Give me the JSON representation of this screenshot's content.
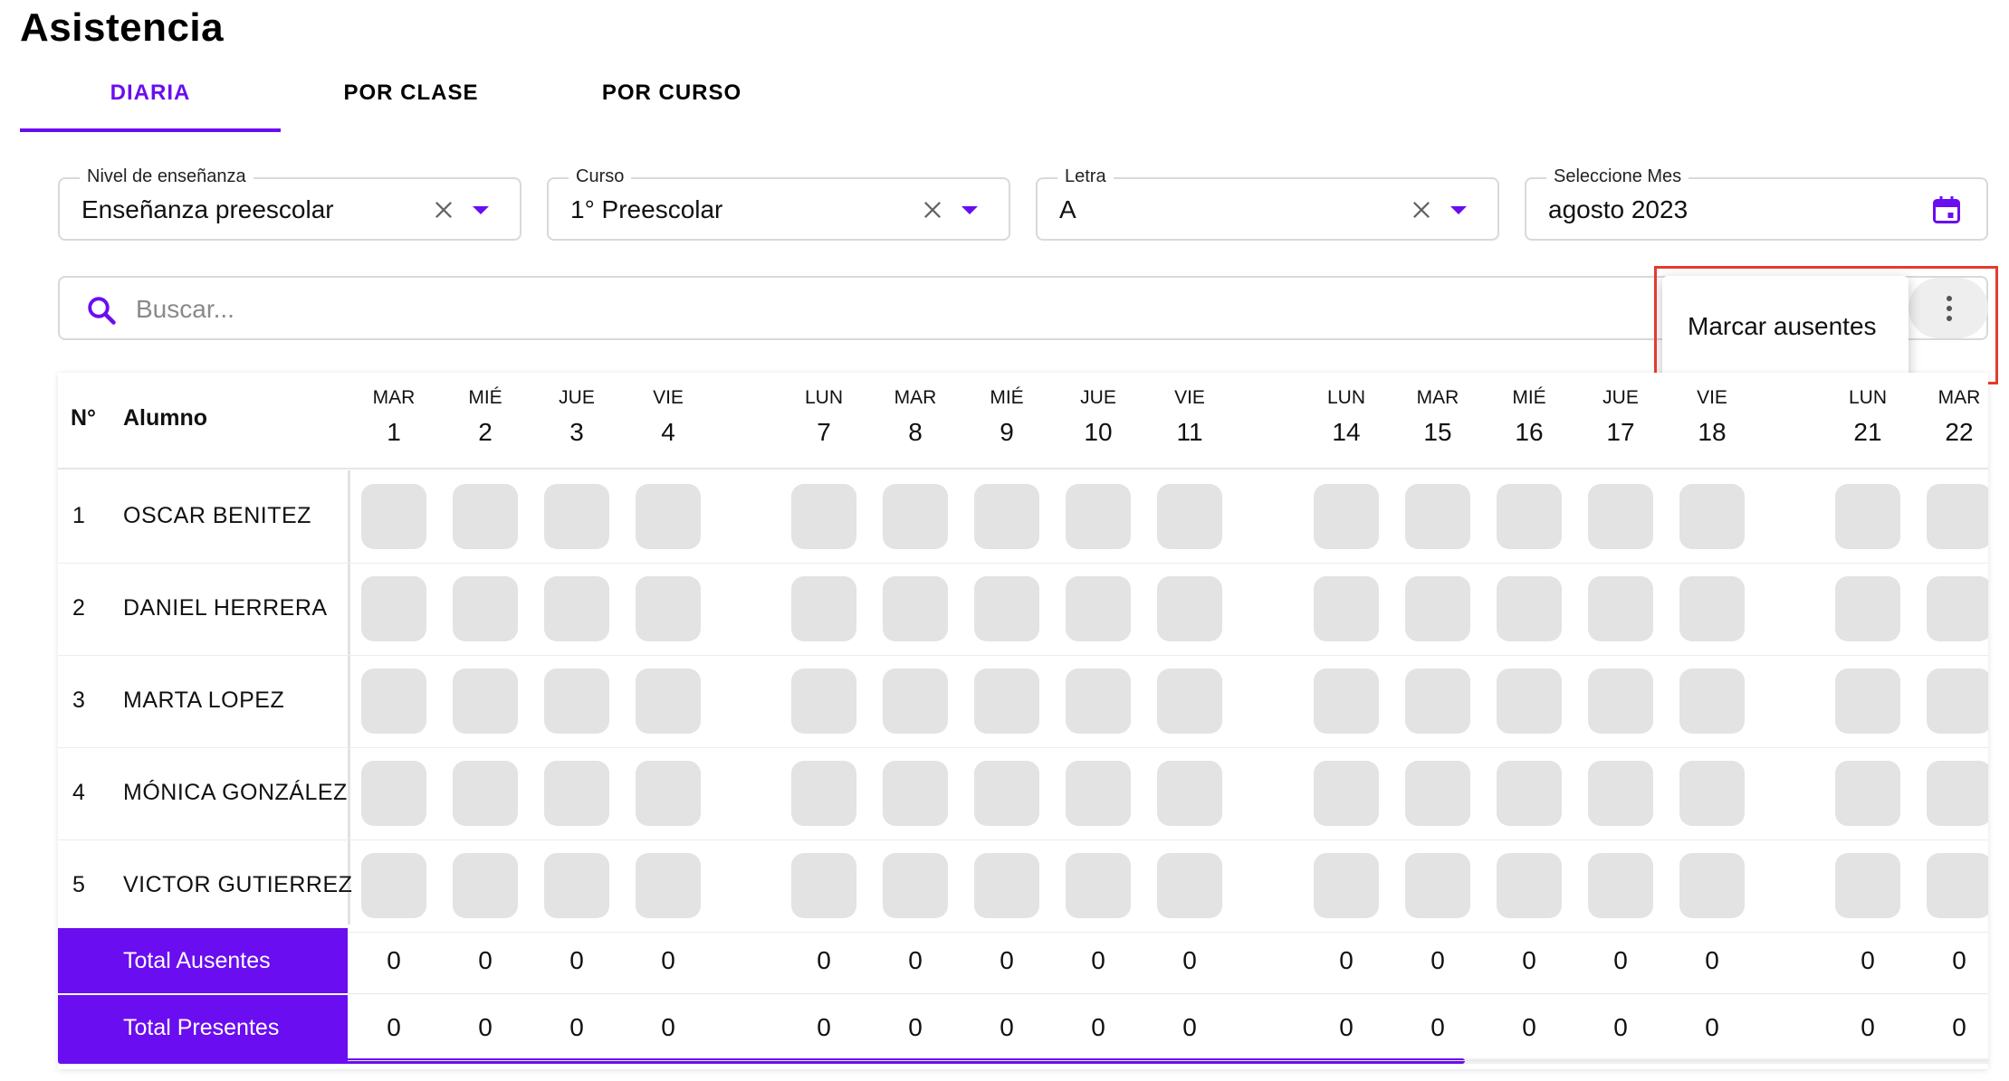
{
  "page_title": "Asistencia",
  "tabs": [
    {
      "label": "DIARIA",
      "active": true
    },
    {
      "label": "POR CLASE",
      "active": false
    },
    {
      "label": "POR CURSO",
      "active": false
    }
  ],
  "filters": {
    "nivel": {
      "label": "Nivel de enseñanza",
      "value": "Enseñanza preescolar"
    },
    "curso": {
      "label": "Curso",
      "value": "1° Preescolar"
    },
    "letra": {
      "label": "Letra",
      "value": "A"
    },
    "mes": {
      "label": "Seleccione Mes",
      "value": "agosto 2023"
    }
  },
  "search": {
    "placeholder": "Buscar..."
  },
  "menu": {
    "items": [
      "Marcar ausentes"
    ]
  },
  "table": {
    "headers": {
      "num": "N°",
      "student": "Alumno"
    },
    "days": [
      {
        "name": "MAR",
        "num": "1"
      },
      {
        "name": "MIÉ",
        "num": "2"
      },
      {
        "name": "JUE",
        "num": "3"
      },
      {
        "name": "VIE",
        "num": "4"
      },
      {
        "name": "LUN",
        "num": "7"
      },
      {
        "name": "MAR",
        "num": "8"
      },
      {
        "name": "MIÉ",
        "num": "9"
      },
      {
        "name": "JUE",
        "num": "10"
      },
      {
        "name": "VIE",
        "num": "11"
      },
      {
        "name": "LUN",
        "num": "14"
      },
      {
        "name": "MAR",
        "num": "15"
      },
      {
        "name": "MIÉ",
        "num": "16"
      },
      {
        "name": "JUE",
        "num": "17"
      },
      {
        "name": "VIE",
        "num": "18"
      },
      {
        "name": "LUN",
        "num": "21"
      },
      {
        "name": "MAR",
        "num": "22"
      }
    ],
    "rows": [
      {
        "num": "1",
        "name": "OSCAR BENITEZ"
      },
      {
        "num": "2",
        "name": "DANIEL HERRERA"
      },
      {
        "num": "3",
        "name": "MARTA LOPEZ"
      },
      {
        "num": "4",
        "name": "MÓNICA GONZÁLEZ"
      },
      {
        "num": "5",
        "name": "VICTOR GUTIERREZ"
      }
    ],
    "totals": [
      {
        "label": "Total Ausentes",
        "values": [
          "0",
          "0",
          "0",
          "0",
          "0",
          "0",
          "0",
          "0",
          "0",
          "0",
          "0",
          "0",
          "0",
          "0",
          "0",
          "0"
        ]
      },
      {
        "label": "Total Presentes",
        "values": [
          "0",
          "0",
          "0",
          "0",
          "0",
          "0",
          "0",
          "0",
          "0",
          "0",
          "0",
          "0",
          "0",
          "0",
          "0",
          "0"
        ]
      }
    ]
  },
  "colors": {
    "accent": "#6a0df0",
    "highlight": "#e43b2d",
    "cell": "#e3e3e3"
  },
  "icons": [
    "clear-icon",
    "dropdown-caret-icon",
    "calendar-icon",
    "search-icon",
    "more-vert-icon"
  ]
}
